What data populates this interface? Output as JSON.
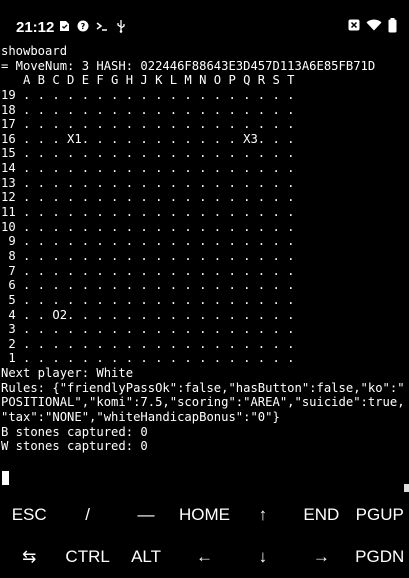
{
  "status_bar": {
    "time": "21:12",
    "left_icons": [
      "sim-card-icon",
      "settings-icon",
      "terminal-prompt-icon",
      "usb-icon"
    ],
    "right_icons": [
      "close-box-icon",
      "wifi-icon",
      "battery-icon"
    ]
  },
  "terminal": {
    "lines": [
      "showboard",
      "= MoveNum: 3 HASH: 022446F88643E3D457D113A6E85FB71D",
      "   A B C D E F G H J K L M N O P Q R S T",
      "19 . . . . . . . . . . . . . . . . . . .",
      "18 . . . . . . . . . . . . . . . . . . .",
      "17 . . . . . . . . . . . . . . . . . . .",
      "16 . . . X1. . . . . . . . . . . X3. . .",
      "15 . . . . . . . . . . . . . . . . . . .",
      "14 . . . . . . . . . . . . . . . . . . .",
      "13 . . . . . . . . . . . . . . . . . . .",
      "12 . . . . . . . . . . . . . . . . . . .",
      "11 . . . . . . . . . . . . . . . . . . .",
      "10 . . . . . . . . . . . . . . . . . . .",
      " 9 . . . . . . . . . . . . . . . . . . .",
      " 8 . . . . . . . . . . . . . . . . . . .",
      " 7 . . . . . . . . . . . . . . . . . . .",
      " 6 . . . . . . . . . . . . . . . . . . .",
      " 5 . . . . . . . . . . . . . . . . . . .",
      " 4 . . O2. . . . . . . . . . . . . . . .",
      " 3 . . . . . . . . . . . . . . . . . . .",
      " 2 . . . . . . . . . . . . . . . . . . .",
      " 1 . . . . . . . . . . . . . . . . . . .",
      "Next player: White",
      "Rules: {\"friendlyPassOk\":false,\"hasButton\":false,\"ko\":\"",
      "POSITIONAL\",\"komi\":7.5,\"scoring\":\"AREA\",\"suicide\":true,",
      "\"tax\":\"NONE\",\"whiteHandicapBonus\":\"0\"}",
      "B stones captured: 0",
      "W stones captured: 0"
    ]
  },
  "extra_keys": {
    "row1": [
      "ESC",
      "/",
      "—",
      "HOME",
      "↑",
      "END",
      "PGUP"
    ],
    "row2": [
      "⇆",
      "CTRL",
      "ALT",
      "←",
      "↓",
      "→",
      "PGDN"
    ]
  }
}
